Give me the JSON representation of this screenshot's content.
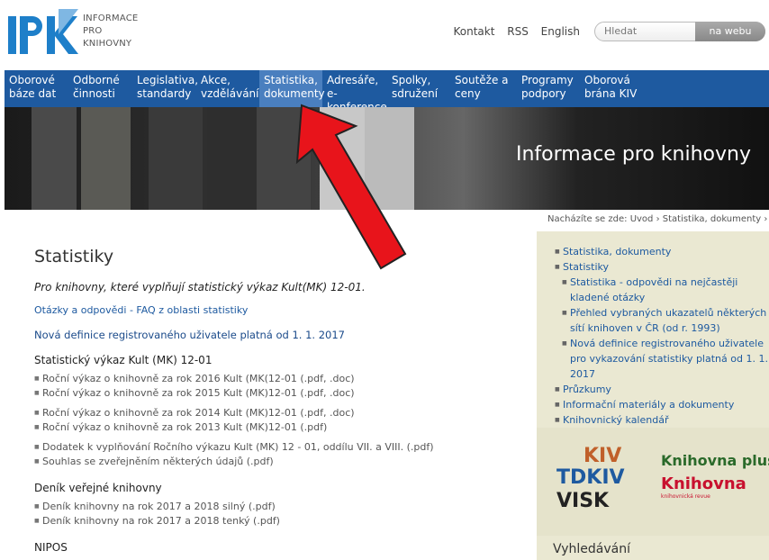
{
  "header": {
    "logo_text_lines": [
      "INFORMACE",
      "PRO",
      "KNIHOVNY"
    ],
    "toplinks": [
      "Kontakt",
      "RSS",
      "English"
    ],
    "search_placeholder": "Hledat",
    "search_button": "na webu"
  },
  "nav": [
    {
      "line1": "Oborové",
      "line2": "báze dat"
    },
    {
      "line1": "Odborné",
      "line2": "činnosti"
    },
    {
      "line1": "Legislativa,",
      "line2": "standardy"
    },
    {
      "line1": "Akce,",
      "line2": "vzdělávání"
    },
    {
      "line1": "Statistika,",
      "line2": "dokumenty",
      "active": true
    },
    {
      "line1": "Adresáře, e-",
      "line2": "konference"
    },
    {
      "line1": "Spolky,",
      "line2": "sdružení"
    },
    {
      "line1": "Soutěže a",
      "line2": "ceny"
    },
    {
      "line1": "Programy",
      "line2": "podpory"
    },
    {
      "line1": "Oborová",
      "line2": "brána KIV"
    }
  ],
  "banner": {
    "title": "Informace pro knihovny"
  },
  "breadcrumb": "Nacházíte se zde: Úvod › Statistika, dokumenty › Statist",
  "main": {
    "title": "Statistiky",
    "intro": "Pro knihovny, které vyplňují statistický výkaz Kult(MK) 12-01.",
    "faq": "Otázky a odpovědi - FAQ z oblasti statistiky",
    "nova": "Nová definice registrovaného uživatele platná od 1. 1. 2017",
    "section1_title": "Statistický výkaz Kult (MK) 12-01",
    "section1_items": [
      "Roční výkaz o knihovně za rok 2016 Kult (MK(12-01 (.pdf, .doc)",
      "Roční výkaz o knihovně za rok 2015 Kult (MK)12-01 (.pdf, .doc)",
      "Roční výkaz o knihovně za rok 2014 Kult (MK)12-01 (.pdf, .doc)",
      "Roční výkaz o knihovně za rok 2013 Kult (MK)12-01 (.pdf)",
      "Dodatek k vyplňování Ročního výkazu Kult (MK) 12 - 01, oddílu VII. a VIII. (.pdf)",
      "Souhlas se zveřejněním některých údajů (.pdf)"
    ],
    "section2_title": "Deník veřejné knihovny",
    "section2_items": [
      "Deník knihovny na rok 2017 a 2018 silný (.pdf)",
      "Deník  knihovny na rok 2017 a 2018 tenký (.pdf)"
    ],
    "section3_title": "NIPOS"
  },
  "sidebar": {
    "items": [
      {
        "label": "Statistika, dokumenty",
        "sub": false
      },
      {
        "label": "Statistiky",
        "sub": false
      },
      {
        "label": "Statistika - odpovědi na nejčastěji kladené otázky",
        "sub": true
      },
      {
        "label": "Přehled vybraných ukazatelů některých sítí knihoven v ČR (od r. 1993)",
        "sub": true
      },
      {
        "label": "Nová definice registrovaného uživatele pro vykazování statistiky platná od 1. 1. 2017",
        "sub": true
      },
      {
        "label": "Průzkumy",
        "sub": false
      },
      {
        "label": "Informační materiály a dokumenty",
        "sub": false
      },
      {
        "label": "Knihovnický kalendář",
        "sub": false
      }
    ],
    "logos": [
      "KIV",
      "TDKIV",
      "VISK",
      "Knihovna plus",
      "Knihovna",
      "knihovnická revue"
    ],
    "search_title": "Vyhledávání"
  },
  "colors": {
    "nav_bg": "#1e5aa0",
    "nav_active": "#4a7fbf",
    "link": "#1e5aa0",
    "sidebar_bg": "#eae8d2",
    "arrow": "#e8141b"
  }
}
